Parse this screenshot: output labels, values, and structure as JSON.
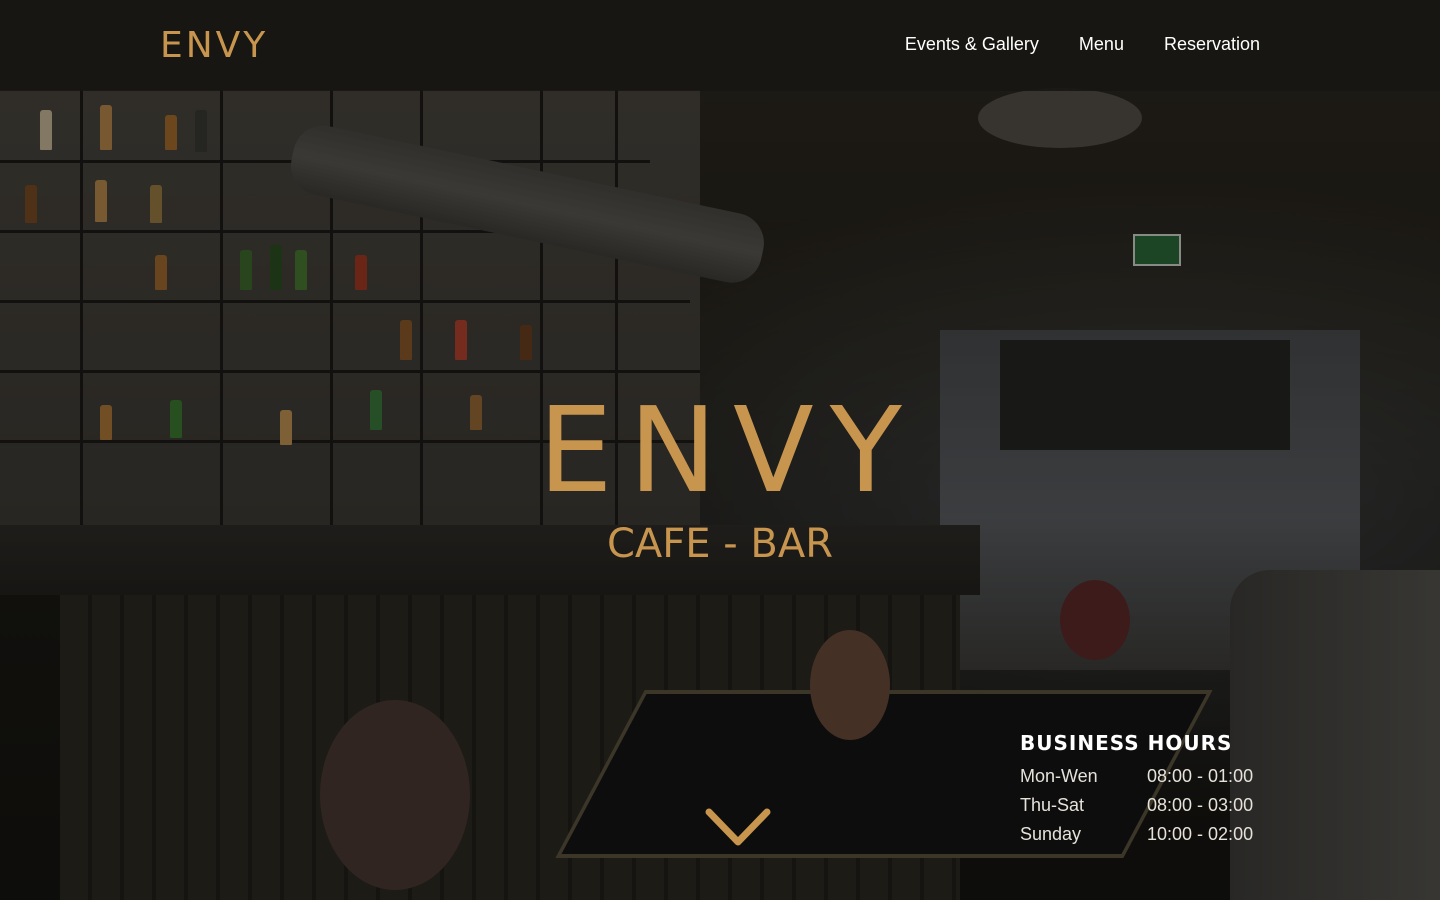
{
  "header": {
    "logo": "ENVY",
    "nav": [
      {
        "label": "Events & Gallery"
      },
      {
        "label": "Menu"
      },
      {
        "label": "Reservation"
      }
    ]
  },
  "hero": {
    "title": "ENVY",
    "subtitle": "CAFE - BAR",
    "scroll_icon": "chevron-down-icon"
  },
  "business_hours": {
    "title": "BUSINESS HOURS",
    "rows": [
      {
        "day": "Mon-Wen",
        "time": "08:00 - 01:00"
      },
      {
        "day": "Thu-Sat",
        "time": "08:00 - 03:00"
      },
      {
        "day": "Sunday",
        "time": "10:00 - 02:00"
      }
    ]
  },
  "colors": {
    "accent": "#c8954f",
    "header_bg": "#181612",
    "text": "#ffffff"
  }
}
